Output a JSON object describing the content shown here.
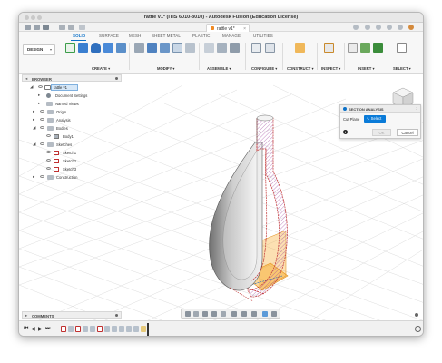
{
  "window": {
    "title": "rattle v1* (ITIS 6010-8010) - Autodesk Fusion (Education License)"
  },
  "document_tab": {
    "label": "rattle v1*",
    "close": "×"
  },
  "workspace": {
    "label": "DESIGN"
  },
  "tabs": [
    "SOLID",
    "SURFACE",
    "MESH",
    "SHEET METAL",
    "PLASTIC",
    "MANAGE",
    "UTILITIES"
  ],
  "active_tab": "SOLID",
  "groups": [
    "CREATE ▾",
    "MODIFY ▾",
    "ASSEMBLE ▾",
    "CONFIGURE ▾",
    "CONSTRUCT ▾",
    "INSPECT ▾",
    "INSERT ▾",
    "SELECT ▾"
  ],
  "browser": {
    "title": "BROWSER",
    "root": "rattle v1",
    "items": [
      {
        "label": "Document Settings",
        "type": "settings"
      },
      {
        "label": "Named Views",
        "type": "folder"
      },
      {
        "label": "Origin",
        "type": "folder"
      },
      {
        "label": "Analysis",
        "type": "folder"
      },
      {
        "label": "Bodies",
        "type": "folder"
      },
      {
        "label": "Body1",
        "type": "body"
      },
      {
        "label": "Sketches",
        "type": "folder"
      },
      {
        "label": "Sketch1",
        "type": "sketch"
      },
      {
        "label": "Sketch2",
        "type": "sketch"
      },
      {
        "label": "Sketch3",
        "type": "sketch"
      },
      {
        "label": "Construction",
        "type": "folder"
      }
    ]
  },
  "section_analysis": {
    "title": "SECTION ANALYSIS",
    "cut_planes_label": "Cut Plane",
    "select_label": "↖ Select",
    "info": "i",
    "ok_label": "OK",
    "cancel_label": "Cancel"
  },
  "comments": {
    "label": "COMMENTS"
  },
  "timeline": {
    "controls": [
      "⏮",
      "◀",
      "▶",
      "⏭"
    ]
  },
  "colors": {
    "accent": "#0a70c8",
    "sketch": "#c03030",
    "plane": "#f5a623",
    "hatch": "#9b3b9b"
  }
}
